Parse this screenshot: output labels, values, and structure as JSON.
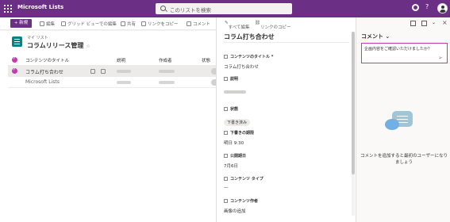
{
  "app": {
    "name": "Microsoft Lists"
  },
  "search": {
    "placeholder": "このリストを検索"
  },
  "toolbar": {
    "new_label": "+ 新規",
    "edit_label": "編集",
    "grid_label": "グリッド ビューでの編集",
    "share_label": "共有",
    "copy_link_label": "リンクをコピー",
    "comment_label": "コメント"
  },
  "list": {
    "site_name": "マイ リスト",
    "title": "コラムリリース管理",
    "columns": [
      "コンテンツのタイトル",
      "説明",
      "作成者",
      "状態"
    ],
    "rows": [
      {
        "title": "コラム打ち合わせ",
        "selected": true
      },
      {
        "title": "Microsoft Lists",
        "selected": false
      }
    ]
  },
  "detail": {
    "edit_all_label": "すべて編集",
    "copy_link_label": "リンクのコピー",
    "title": "コラム打ち合わせ",
    "fields": [
      {
        "label": "コンテンツのタイトル *",
        "value": "コラム打ち合わせ",
        "kind": "text"
      },
      {
        "label": "説明",
        "value": "",
        "kind": "blur"
      },
      {
        "label": "状態",
        "value": "下書き済み",
        "kind": "pill"
      },
      {
        "label": "下書きの期限",
        "value": "明日 9:30",
        "kind": "text"
      },
      {
        "label": "公開期日",
        "value": "7月6日",
        "kind": "text"
      },
      {
        "label": "コンテンツ タイプ",
        "value": "—",
        "kind": "text"
      },
      {
        "label": "コンテンツ作者",
        "value": "画像の追加",
        "kind": "text"
      }
    ]
  },
  "comments": {
    "header": "コメント ⌄",
    "input_value": "企画内容をご確認いただけましたか？",
    "send_icon": "send-icon",
    "empty_text": "コメントを追加すると最初のユーザーになりましょう"
  },
  "colors": {
    "brand": "#6b2f86",
    "accent": "#c239b3"
  }
}
